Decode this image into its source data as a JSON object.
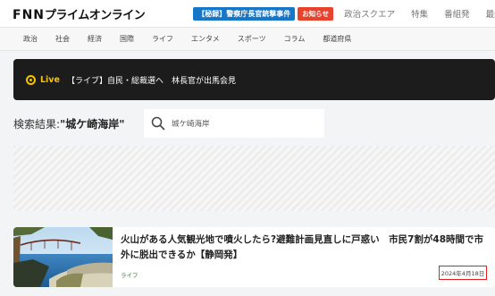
{
  "header": {
    "logo_prefix": "FNN",
    "logo_suffix": "プライムオンライン",
    "breaking_badge": "【秘録】警察庁長官銃撃事件",
    "notice_badge": "お知らせ",
    "nav": [
      "政治スクエア",
      "特集",
      "番組発",
      "最新ニ"
    ]
  },
  "category_nav": [
    "政治",
    "社会",
    "経済",
    "国際",
    "ライフ",
    "エンタメ",
    "スポーツ",
    "コラム",
    "都道府県"
  ],
  "live_banner": {
    "label": "Live",
    "text": "【ライブ】自民・総裁選へ　林長官が出馬会見"
  },
  "search": {
    "result_prefix": "検索結果:",
    "result_term": "\"城ケ崎海岸\"",
    "query": "城ケ崎海岸"
  },
  "article": {
    "title": "火山がある人気観光地で噴火したら?避難計画見直しに戸惑い　市民7割が48時間で市外に脱出できるか【静岡発】",
    "category": "ライフ",
    "date": "2024年4月18日"
  }
}
